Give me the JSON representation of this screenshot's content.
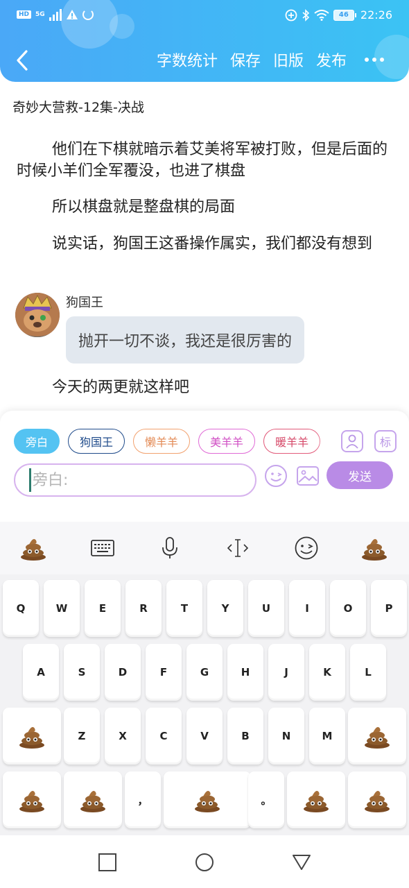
{
  "status_bar": {
    "hd": "HD",
    "network": "5G",
    "battery": "46",
    "time": "22:26"
  },
  "header": {
    "actions": [
      "字数统计",
      "保存",
      "旧版",
      "发布"
    ]
  },
  "document": {
    "title": "奇妙大营救-12集-决战",
    "paragraphs": [
      "他们在下棋就暗示着艾美将军被打败，但是后面的时候小羊们全军覆没，也进了棋盘",
      "所以棋盘就是整盘棋的局面",
      "说实话，狗国王这番操作属实，我们都没有想到"
    ],
    "dialogue": {
      "speaker": "狗国王",
      "text": "抛开一切不谈，我还是很厉害的"
    },
    "last_paragraph": "今天的两更就这样吧"
  },
  "composer": {
    "roles": [
      "旁白",
      "狗国王",
      "懒羊羊",
      "美羊羊",
      "暖羊羊"
    ],
    "person_icon": "person-icon",
    "tag_label": "标",
    "input_placeholder": "旁白:",
    "send_label": "发送"
  },
  "keyboard": {
    "toolbar_icons": [
      "poop-emoji",
      "keyboard-icon",
      "microphone-icon",
      "cursor-icon",
      "wink-face-icon",
      "poop-emoji"
    ],
    "row1": [
      "Q",
      "W",
      "E",
      "R",
      "T",
      "Y",
      "U",
      "I",
      "O",
      "P"
    ],
    "row2": [
      "A",
      "S",
      "D",
      "F",
      "G",
      "H",
      "J",
      "K",
      "L"
    ],
    "row3": [
      "Z",
      "X",
      "C",
      "V",
      "B",
      "N",
      "M"
    ],
    "row4_comma": "，",
    "row4_period": "。"
  },
  "navbar": {
    "icons": [
      "square-recents-icon",
      "circle-home-icon",
      "triangle-back-icon"
    ]
  },
  "colors": {
    "header_start": "#4aa8f7",
    "header_end": "#3bc3f4",
    "accent_purple": "#b98be6",
    "active_chip": "#54c3f2"
  }
}
